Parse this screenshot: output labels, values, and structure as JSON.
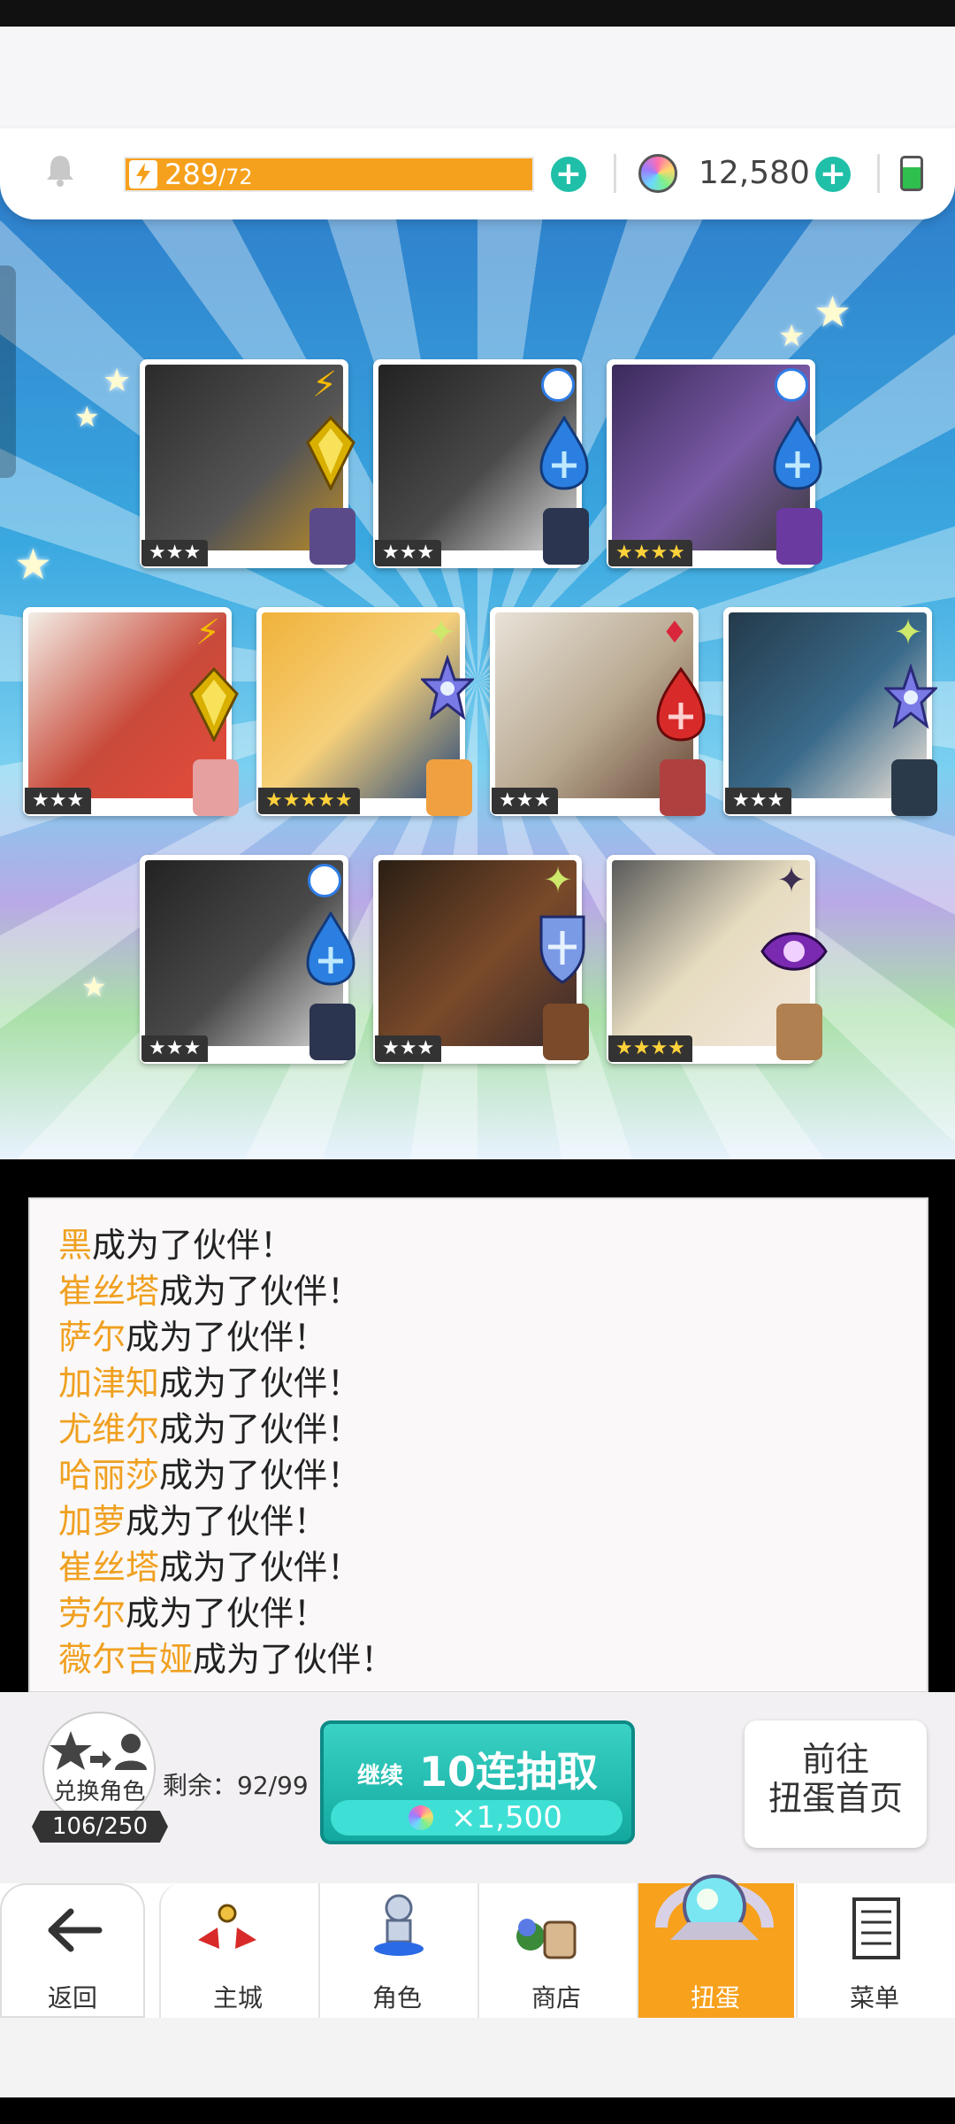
{
  "resources": {
    "energy_current": "289",
    "energy_max": "/72",
    "gems": "12,580"
  },
  "cards": [
    {
      "name": "黑",
      "stars": "★★★",
      "element": "lightning-icon",
      "gold": false
    },
    {
      "name": "崔丝塔",
      "stars": "★★★",
      "element": "water-icon",
      "gold": false
    },
    {
      "name": "萨尔",
      "stars": "★★★★",
      "element": "water-icon",
      "gold": true
    },
    {
      "name": "加津知",
      "stars": "★★★",
      "element": "lightning-icon",
      "gold": false
    },
    {
      "name": "尤维尔",
      "stars": "★★★★★",
      "element": "light-icon",
      "gold": true
    },
    {
      "name": "哈丽莎",
      "stars": "★★★",
      "element": "fire-icon",
      "gold": false
    },
    {
      "name": "加萝",
      "stars": "★★★",
      "element": "light-icon",
      "gold": false
    },
    {
      "name": "崔丝塔",
      "stars": "★★★",
      "element": "water-icon",
      "gold": false
    },
    {
      "name": "劳尔",
      "stars": "★★★",
      "element": "light-icon",
      "gold": false
    },
    {
      "name": "薇尔吉娅",
      "stars": "★★★★",
      "element": "dark-icon",
      "gold": true
    }
  ],
  "log": {
    "suffix": "成为了伙伴！",
    "names": [
      "黑",
      "崔丝塔",
      "萨尔",
      "加津知",
      "尤维尔",
      "哈丽莎",
      "加萝",
      "崔丝塔",
      "劳尔",
      "薇尔吉娅"
    ]
  },
  "exchange": {
    "label": "兑换角色",
    "count": "106/250"
  },
  "remaining": "剩余：92/99",
  "pull": {
    "prefix": "继续",
    "label": "10连抽取",
    "cost": "×1,500"
  },
  "goto": {
    "line1": "前往",
    "line2": "扭蛋首页"
  },
  "nav": {
    "back": "返回",
    "items": [
      "主城",
      "角色",
      "商店",
      "扭蛋",
      "菜单"
    ],
    "active": "扭蛋"
  },
  "colors": {
    "accent_orange": "#f7a11d",
    "teal": "#1fbfa8",
    "name_highlight": "#f0a020"
  }
}
